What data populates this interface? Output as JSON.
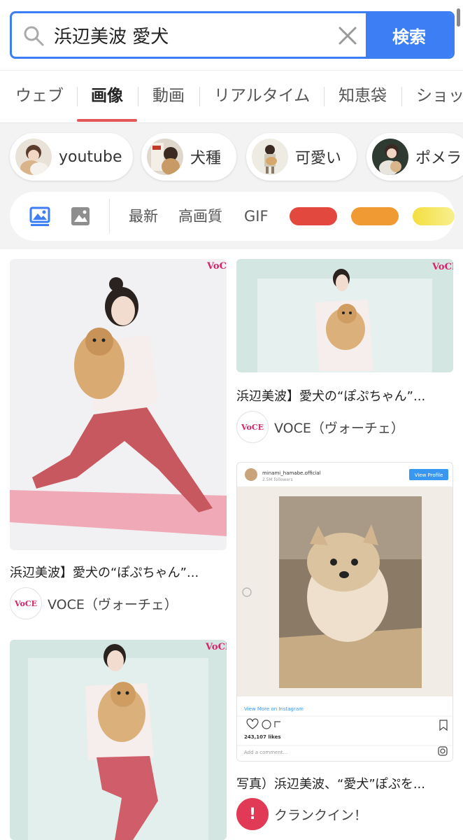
{
  "search": {
    "query": "浜辺美波 愛犬",
    "button_label": "検索"
  },
  "tabs": [
    {
      "label": "ウェブ",
      "active": false
    },
    {
      "label": "画像",
      "active": true
    },
    {
      "label": "動画",
      "active": false
    },
    {
      "label": "リアルタイム",
      "active": false
    },
    {
      "label": "知恵袋",
      "active": false
    },
    {
      "label": "ショッ",
      "active": false
    }
  ],
  "suggest_chips": [
    {
      "label": "youtube"
    },
    {
      "label": "犬種"
    },
    {
      "label": "可愛い"
    },
    {
      "label": "ポメラ"
    }
  ],
  "filters": {
    "sort_new": "最新",
    "high_quality": "高画質",
    "gif": "GIF",
    "colors": [
      "#e2483d",
      "#ef9a32",
      "#f5e34a"
    ]
  },
  "results": [
    {
      "title": "浜辺美波】愛犬の“ぽぷちゃん”...",
      "source": "VOCE（ヴォーチェ）",
      "logo_text": "VoCE"
    },
    {
      "title": "浜辺美波】愛犬の“ぽぷちゃん”...",
      "source": "VOCE（ヴォーチェ）",
      "logo_text": "VoCE"
    },
    {
      "title": "写真）浜辺美波、“愛犬”ぽぷを...",
      "source": "クランクイン！",
      "logo_text": "!"
    }
  ],
  "image_overlays": {
    "voce_mark": "VoCE",
    "insta_handle": "minami_hamabe.official",
    "insta_followers": "2.5M followers",
    "insta_view_profile": "View Profile",
    "insta_view_more": "View More on Instagram",
    "insta_likes": "243,107 likes",
    "insta_comment": "Add a comment..."
  }
}
